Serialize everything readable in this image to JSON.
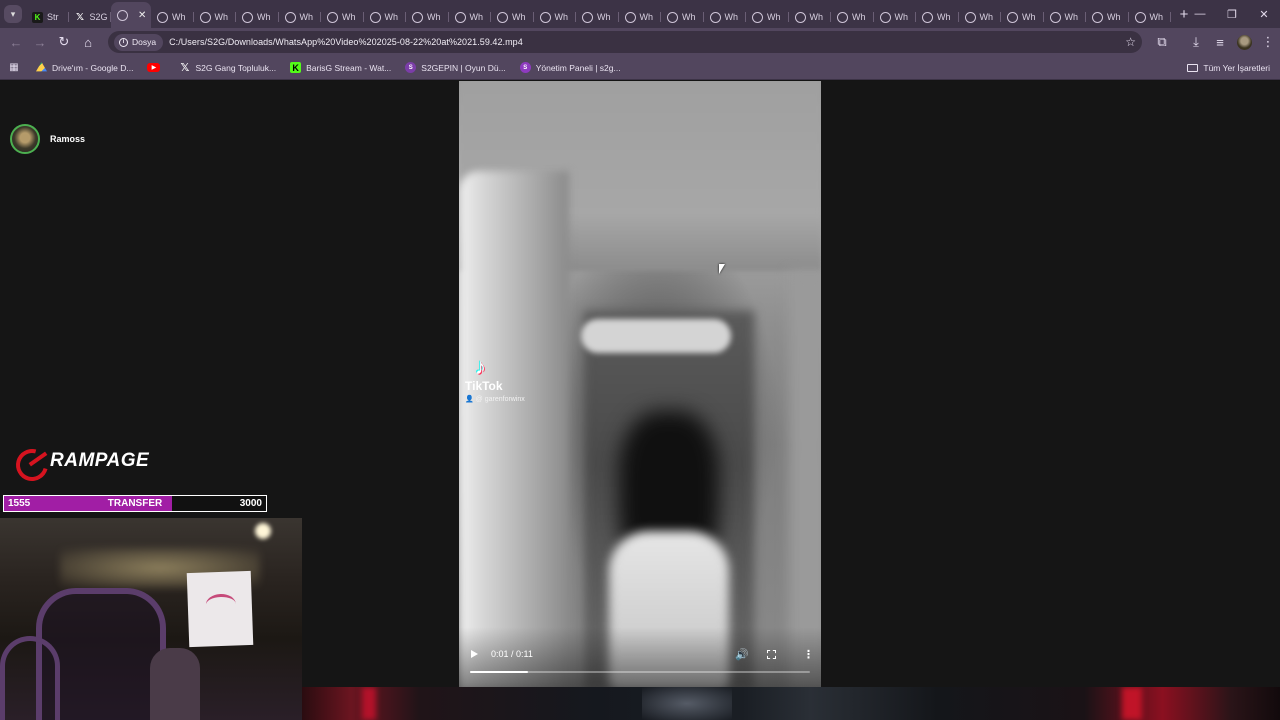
{
  "browser": {
    "tabs": [
      {
        "label": "Str",
        "favicon": "kick-icon"
      },
      {
        "label": "S2G",
        "favicon": "x-icon"
      },
      {
        "label": "",
        "favicon": "globe-icon",
        "active": true
      },
      {
        "label": "Wh",
        "favicon": "globe-icon"
      },
      {
        "label": "Wh",
        "favicon": "globe-icon"
      },
      {
        "label": "Wh",
        "favicon": "globe-icon"
      },
      {
        "label": "Wh",
        "favicon": "globe-icon"
      },
      {
        "label": "Wh",
        "favicon": "globe-icon"
      },
      {
        "label": "Wh",
        "favicon": "globe-icon"
      },
      {
        "label": "Wh",
        "favicon": "globe-icon"
      },
      {
        "label": "Wh",
        "favicon": "globe-icon"
      },
      {
        "label": "Wh",
        "favicon": "globe-icon"
      },
      {
        "label": "Wh",
        "favicon": "globe-icon"
      },
      {
        "label": "Wh",
        "favicon": "globe-icon"
      },
      {
        "label": "Wh",
        "favicon": "globe-icon"
      },
      {
        "label": "Wh",
        "favicon": "globe-icon"
      },
      {
        "label": "Wh",
        "favicon": "globe-icon"
      },
      {
        "label": "Wh",
        "favicon": "globe-icon"
      },
      {
        "label": "Wh",
        "favicon": "globe-icon"
      },
      {
        "label": "Wh",
        "favicon": "globe-icon"
      },
      {
        "label": "Wh",
        "favicon": "globe-icon"
      },
      {
        "label": "Wh",
        "favicon": "globe-icon"
      },
      {
        "label": "Wh",
        "favicon": "globe-icon"
      },
      {
        "label": "Wh",
        "favicon": "globe-icon"
      },
      {
        "label": "Wh",
        "favicon": "globe-icon"
      },
      {
        "label": "Wh",
        "favicon": "globe-icon"
      },
      {
        "label": "Wh",
        "favicon": "globe-icon"
      }
    ],
    "new_tab": "+",
    "omnibox": {
      "chip_label": "Dosya",
      "url": "C:/Users/S2G/Downloads/WhatsApp%20Video%202025-08-22%20at%2021.59.42.mp4"
    },
    "bookmarks": [
      {
        "label": "Drive'ım - Google D...",
        "icon": "google-drive-icon"
      },
      {
        "label": "",
        "icon": "youtube-icon"
      },
      {
        "label": "S2G Gang Topluluk...",
        "icon": "x-icon"
      },
      {
        "label": "BarisG Stream - Wat...",
        "icon": "kick-icon"
      },
      {
        "label": "S2GEPIN | Oyun Dü...",
        "icon": "s2g-icon"
      },
      {
        "label": "Yönetim Paneli | s2g...",
        "icon": "panel-icon"
      }
    ],
    "all_bookmarks": "Tüm Yer İşaretleri"
  },
  "video": {
    "watermark_brand": "TikTok",
    "watermark_handle": "@ garenforwinx",
    "time": "0:01 / 0:11",
    "progress": 0.17
  },
  "overlay": {
    "streamer_name": "Ramoss",
    "sponsor": "RAMPAGE",
    "goal": {
      "current": "1555",
      "label": "TRANSFER",
      "target": "3000"
    }
  }
}
